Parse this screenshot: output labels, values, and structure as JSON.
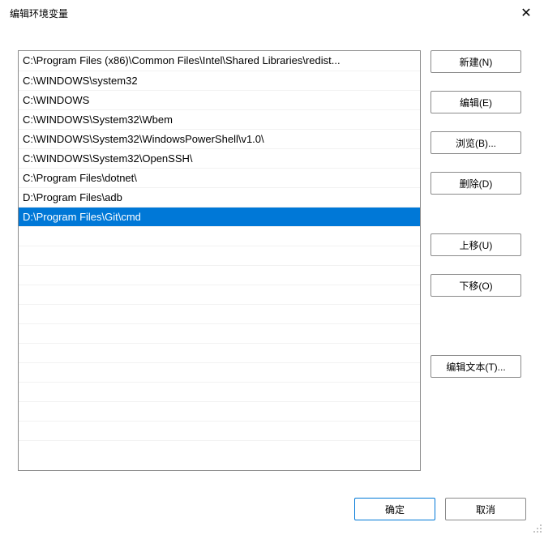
{
  "title": "编辑环境变量",
  "close_symbol": "✕",
  "paths": [
    "C:\\Program Files (x86)\\Common Files\\Intel\\Shared Libraries\\redist...",
    "C:\\WINDOWS\\system32",
    "C:\\WINDOWS",
    "C:\\WINDOWS\\System32\\Wbem",
    "C:\\WINDOWS\\System32\\WindowsPowerShell\\v1.0\\",
    "C:\\WINDOWS\\System32\\OpenSSH\\",
    "C:\\Program Files\\dotnet\\",
    "D:\\Program Files\\adb",
    "D:\\Program Files\\Git\\cmd"
  ],
  "selected_index": 8,
  "total_rows": 21,
  "buttons": {
    "new": "新建(N)",
    "edit": "编辑(E)",
    "browse": "浏览(B)...",
    "delete": "删除(D)",
    "move_up": "上移(U)",
    "move_down": "下移(O)",
    "edit_text": "编辑文本(T)...",
    "ok": "确定",
    "cancel": "取消"
  }
}
